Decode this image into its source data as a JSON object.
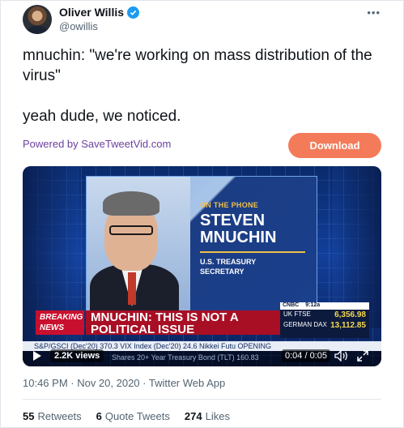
{
  "author": {
    "name": "Oliver Willis",
    "handle": "@owillis"
  },
  "tweet": {
    "text": "mnuchin: \"we're working on mass distribution of the virus\"\n\nyeah dude, we noticed."
  },
  "promo": {
    "powered_by": "Powered by SaveTweetVid.com",
    "download_label": "Download"
  },
  "video": {
    "on_the_phone": "ON THE PHONE",
    "name_line1": "STEVEN",
    "name_line2": "MNUCHIN",
    "role_line1": "U.S. TREASURY",
    "role_line2": "SECRETARY",
    "breaking_line1": "BREAKING",
    "breaking_line2": "NEWS",
    "headline": "MNUCHIN: THIS IS NOT A POLITICAL ISSUE",
    "network": "CNBC",
    "clock": "9:12a",
    "ticker": [
      {
        "label": "UK FTSE",
        "value": "6,356.98"
      },
      {
        "label": "GERMAN DAX",
        "value": "13,112.85"
      }
    ],
    "crawl": "S&P/GSCI (Dec'20) 370.3   VIX Index (Dec'20) 24.6   Nikkei Futu  OPENING",
    "crawl_lower": "Shares 20+ Year Treasury Bond (TLT) 160.83",
    "views": "2.2K views",
    "time": "0:04 / 0:05"
  },
  "meta": {
    "timestamp": "10:46 PM · Nov 20, 2020 · Twitter Web App"
  },
  "stats": {
    "retweets_count": "55",
    "retweets_label": "Retweets",
    "quotes_count": "6",
    "quotes_label": "Quote Tweets",
    "likes_count": "274",
    "likes_label": "Likes"
  },
  "colors": {
    "verified": "#1d9bf0",
    "download_button": "#f47b5a",
    "powered_link": "#6b3fa0",
    "breaking_red": "#c8102e"
  },
  "icons": [
    "verified-icon",
    "more-icon",
    "play-icon",
    "volume-icon",
    "fullscreen-icon"
  ]
}
